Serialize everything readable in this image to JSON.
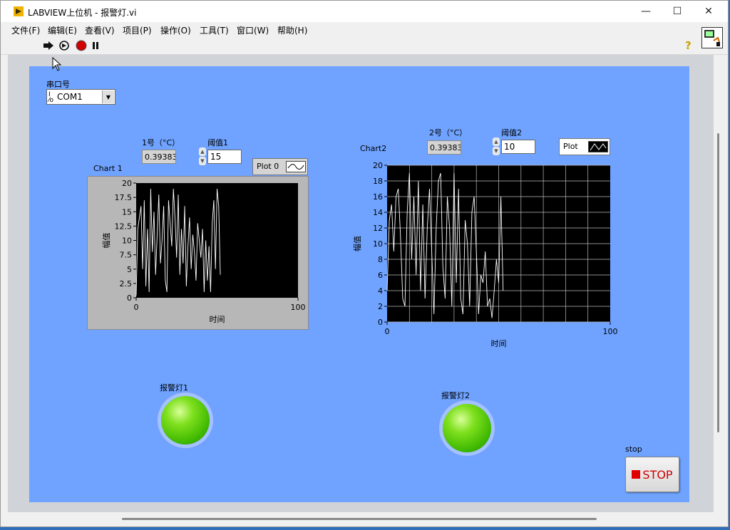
{
  "window": {
    "title": "LABVIEW上位机 - 报警灯.vi"
  },
  "titlebar_buttons": {
    "minimize": "—",
    "maximize": "☐",
    "close": "✕"
  },
  "menu": [
    "文件(F)",
    "编辑(E)",
    "查看(V)",
    "项目(P)",
    "操作(O)",
    "工具(T)",
    "窗口(W)",
    "帮助(H)"
  ],
  "toolbar": {
    "help": "?"
  },
  "serial": {
    "label": "串口号",
    "io_prefix": "I/O",
    "value": "COM1"
  },
  "channel1": {
    "label": "1号（°C）",
    "value": "0.39383",
    "threshold_label": "阈值1",
    "threshold": "15"
  },
  "channel2": {
    "label": "2号（°C）",
    "value": "0.39383",
    "threshold_label": "阈值2",
    "threshold": "10"
  },
  "chart1": {
    "title": "Chart 1",
    "legend": "Plot 0"
  },
  "chart2": {
    "title": "Chart2",
    "legend": "Plot"
  },
  "alarm1": {
    "label": "报警灯1"
  },
  "alarm2": {
    "label": "报警灯2"
  },
  "stop": {
    "label": "stop",
    "button_text": "STOP"
  },
  "colors": {
    "panel": "#6fa3ff",
    "plot_bg": "#000000",
    "trace": "#ffffff",
    "led_on": "#66dd11",
    "stop_red": "#e00000"
  },
  "chart_data": [
    {
      "type": "line",
      "title": "Chart 1",
      "xlabel": "时间",
      "ylabel": "幅值",
      "xlim": [
        0,
        100
      ],
      "ylim": [
        0,
        20
      ],
      "yticks": [
        "0",
        "2.5",
        "5",
        "7.5",
        "10",
        "12.5",
        "15",
        "17.5",
        "20"
      ],
      "xticks": [
        "0",
        "100"
      ],
      "grid": false,
      "series": [
        {
          "name": "Plot 0",
          "y": [
            0.4,
            12,
            14,
            16,
            5,
            17,
            2,
            12,
            1,
            19,
            8,
            15,
            4,
            11,
            18,
            6,
            10,
            16,
            3,
            1,
            17,
            13,
            9,
            19,
            14,
            7,
            18,
            4,
            12,
            6,
            16,
            2,
            9,
            14,
            5,
            11,
            8,
            3,
            13,
            10,
            7,
            12,
            1,
            10,
            3,
            9,
            1,
            13,
            17,
            5,
            19,
            16,
            4
          ]
        }
      ]
    },
    {
      "type": "line",
      "title": "Chart2",
      "xlabel": "时间",
      "ylabel": "幅值",
      "xlim": [
        0,
        100
      ],
      "ylim": [
        0,
        20
      ],
      "yticks": [
        "0",
        "2",
        "4",
        "6",
        "8",
        "10",
        "12",
        "14",
        "16",
        "18",
        "20"
      ],
      "xticks": [
        "0",
        "100"
      ],
      "grid": true,
      "series": [
        {
          "name": "Plot",
          "y": [
            4,
            13,
            15,
            9,
            16,
            17,
            11,
            3,
            2,
            14,
            19,
            8,
            16,
            6,
            18,
            4,
            15,
            3,
            12,
            17,
            9,
            1,
            12,
            18,
            19,
            7,
            3,
            16,
            12,
            2,
            19,
            5,
            17,
            3,
            1,
            13,
            10,
            2,
            14,
            16,
            9,
            1,
            6,
            5,
            9,
            2,
            3,
            0.5,
            4,
            8,
            5,
            16,
            4
          ]
        }
      ]
    }
  ]
}
